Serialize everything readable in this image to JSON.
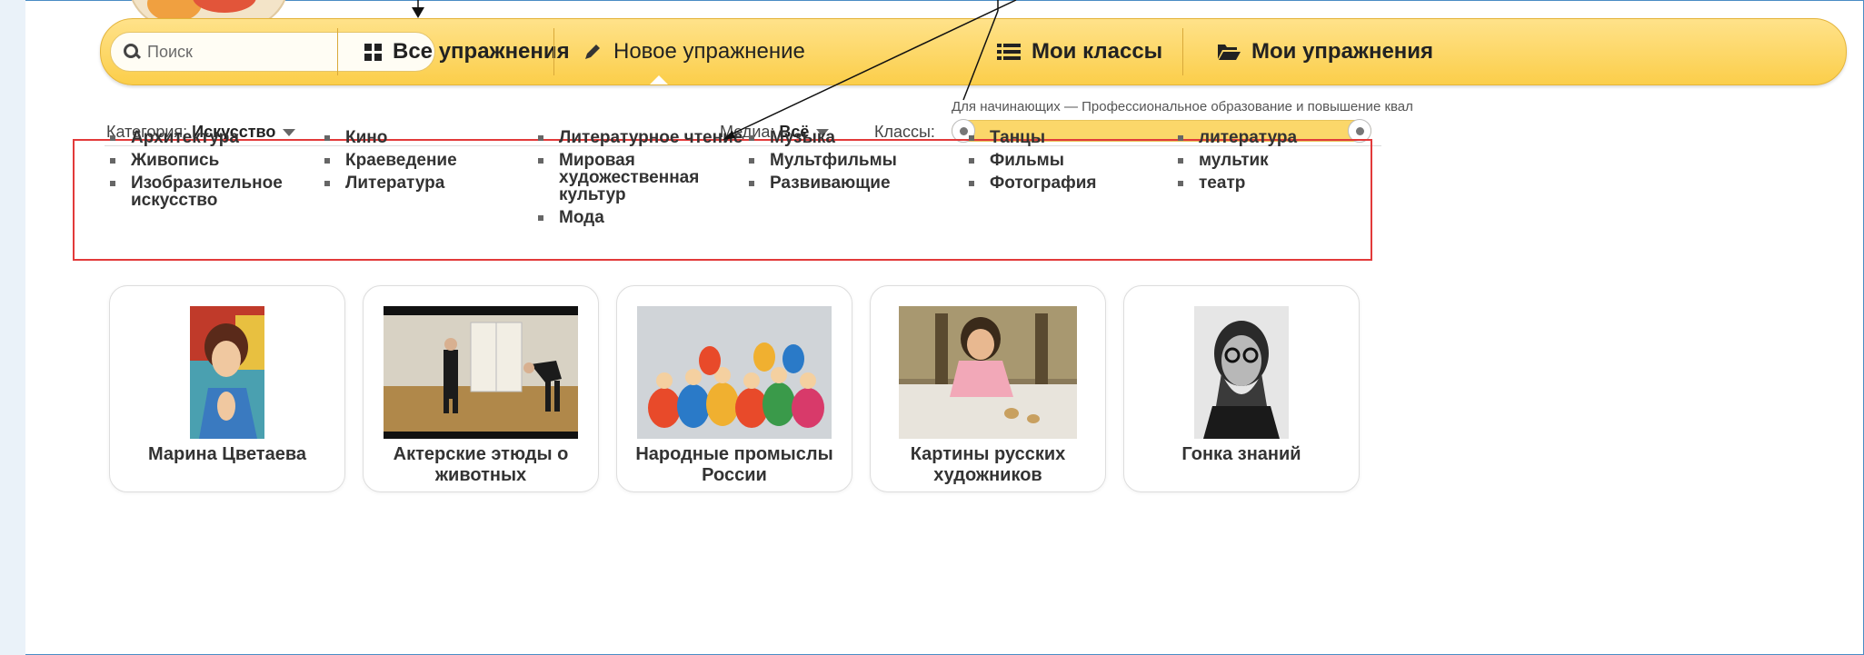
{
  "toolbar": {
    "search_placeholder": "Поиск",
    "all_exercises": "Все упражнения",
    "new_exercise": "Новое упражнение",
    "my_classes": "Мои классы",
    "my_exercises": "Мои упражнения",
    "icons": [
      "search-icon",
      "grid-icon",
      "pencil-icon",
      "list-icon",
      "folder-icon"
    ]
  },
  "filters": {
    "category_label": "Категория:",
    "category_value": "Искусство",
    "media_label": "Медиа:",
    "media_value": "Всё",
    "classes_label": "Классы:",
    "classes_hint": "Для начинающих — Профессиональное образование и повышение квал"
  },
  "categories": [
    [
      "Архитектура",
      "Живопись",
      "Изобразительное искусство"
    ],
    [
      "Кино",
      "Краеведение",
      "Литература"
    ],
    [
      "Литературное чтение",
      "Мировая художественная культур",
      "Мода"
    ],
    [
      "Музыка",
      "Мультфильмы",
      "Развивающие"
    ],
    [
      "Танцы",
      "Фильмы",
      "Фотография"
    ],
    [
      "литература",
      "мультик",
      "театр"
    ]
  ],
  "cards": [
    {
      "title": "Марина Цветаева"
    },
    {
      "title": "Актерские этюды о животных"
    },
    {
      "title": "Народные промыслы России"
    },
    {
      "title": "Картины русских художников"
    },
    {
      "title": "Гонка знаний"
    }
  ],
  "colors": {
    "toolbar": "#fbce4a",
    "highlight_box": "#e23a3a",
    "frame": "#4a8cc4"
  }
}
